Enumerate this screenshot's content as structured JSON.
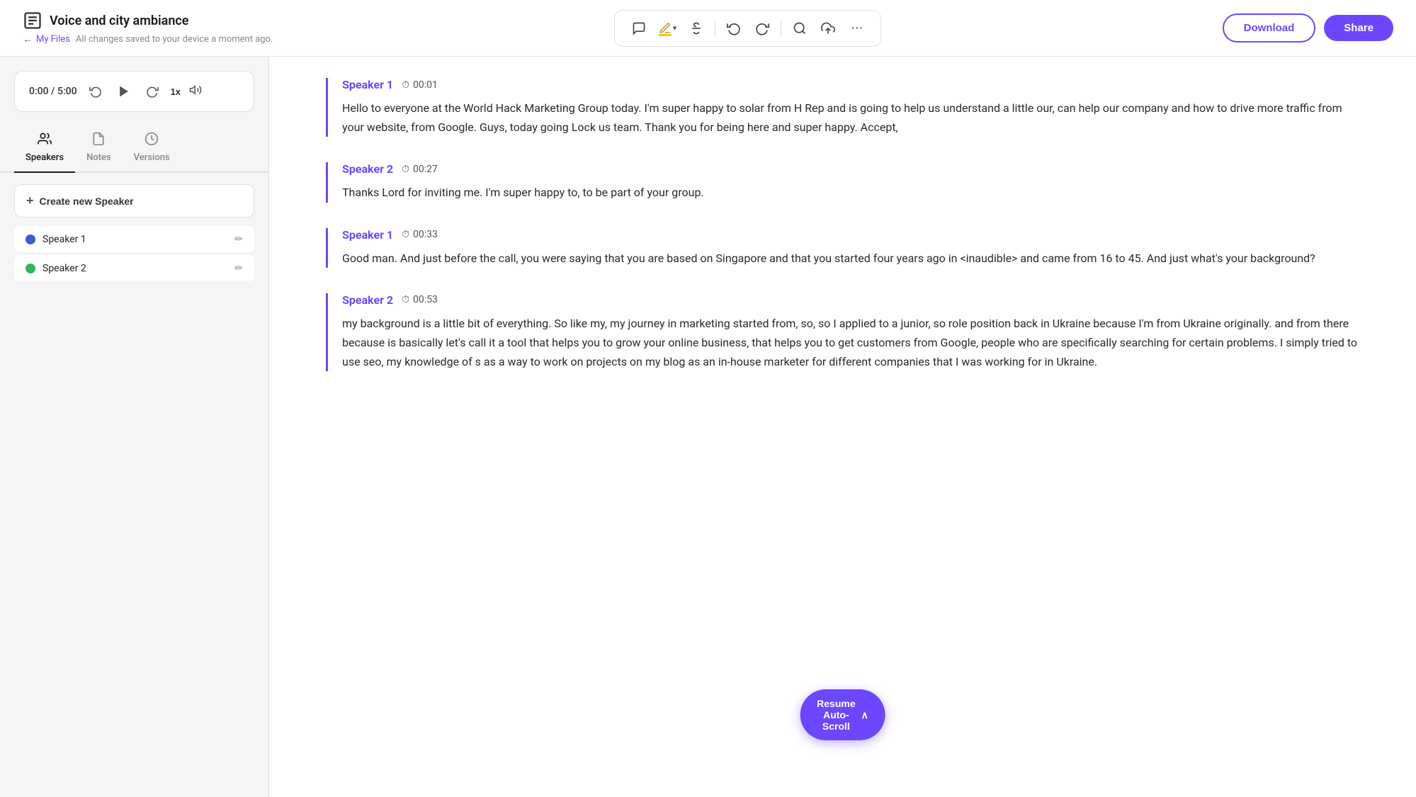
{
  "header": {
    "title": "Voice and city ambiance",
    "back_label": "My Files",
    "autosave_text": "All changes saved to your device a moment ago.",
    "download_label": "Download",
    "share_label": "Share"
  },
  "toolbar": {
    "comment_icon": "💬",
    "pen_icon": "✏️",
    "chevron_icon": "▾",
    "strikethrough_icon": "S",
    "undo_icon": "↩",
    "redo_icon": "↪",
    "search_icon": "🔍",
    "upload_icon": "⬆",
    "more_icon": "•••"
  },
  "player": {
    "current_time": "0:00",
    "total_time": "5:00",
    "speed": "1x"
  },
  "tabs": [
    {
      "id": "speakers",
      "label": "Speakers",
      "active": true
    },
    {
      "id": "notes",
      "label": "Notes",
      "active": false
    },
    {
      "id": "versions",
      "label": "Versions",
      "active": false
    }
  ],
  "speakers": [
    {
      "name": "Speaker 1",
      "color": "#3b5bdb"
    },
    {
      "name": "Speaker 2",
      "color": "#2db55d"
    }
  ],
  "create_speaker_label": "Create new Speaker",
  "transcript": [
    {
      "speaker": "Speaker 1",
      "timestamp": "00:01",
      "text": "Hello to everyone at the World Hack Marketing Group today. I'm super happy to solar from H Rep and is going to help us understand a little our, can help our company and how to drive more traffic from your website, from Google. Guys, today going Lock us team. Thank you for being here and super happy. Accept,"
    },
    {
      "speaker": "Speaker 2",
      "timestamp": "00:27",
      "text": "Thanks Lord for inviting me. I'm super happy to, to be part of your group."
    },
    {
      "speaker": "Speaker 1",
      "timestamp": "00:33",
      "text": "Good man. And just before the call, you were saying that you are based on Singapore and that you started four years ago in <inaudible> and came from 16 to 45. And just what's your background?"
    },
    {
      "speaker": "Speaker 2",
      "timestamp": "00:53",
      "text": " my background is a little bit of everything. So like my, my journey in marketing started from, so, so I applied to a junior, so role position back in Ukraine because I'm from Ukraine originally. and from there because is basically let's call it a tool that helps you to grow your online business, that helps you to get customers from Google, people who are specifically searching for certain problems. I simply tried to use seo, my knowledge of s as a way to work on projects on my blog as an in-house marketer for different companies that I was working for in Ukraine."
    }
  ],
  "resume_scroll_label": "Resume Auto-Scroll",
  "resume_scroll_icon": "∧"
}
